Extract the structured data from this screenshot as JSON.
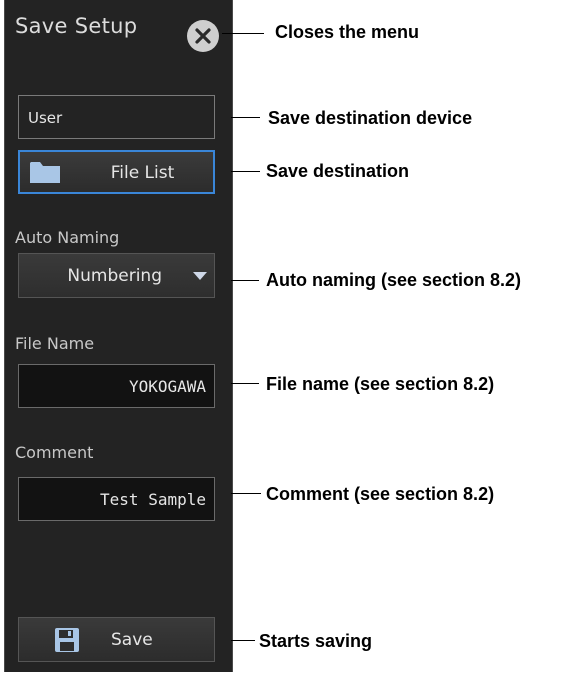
{
  "panel": {
    "title": "Save Setup",
    "close_icon": "close-icon",
    "device_value": "User",
    "file_list_label": "File List",
    "folder_icon": "folder-icon",
    "auto_naming_label": "Auto Naming",
    "auto_naming_value": "Numbering",
    "file_name_label": "File Name",
    "file_name_value": "YOKOGAWA",
    "comment_label": "Comment",
    "comment_value": "Test Sample",
    "save_label": "Save",
    "save_icon": "floppy-disk-icon"
  },
  "callouts": {
    "close": "Closes the menu",
    "device": "Save destination device",
    "destination": "Save destination",
    "auto_naming": "Auto naming (see section 8.2)",
    "file_name": "File name (see section 8.2)",
    "comment": "Comment (see section 8.2)",
    "save": "Starts saving"
  },
  "colors": {
    "panel_bg": "#232323",
    "accent_border": "#3a86d8",
    "folder": "#a9c6e6"
  }
}
